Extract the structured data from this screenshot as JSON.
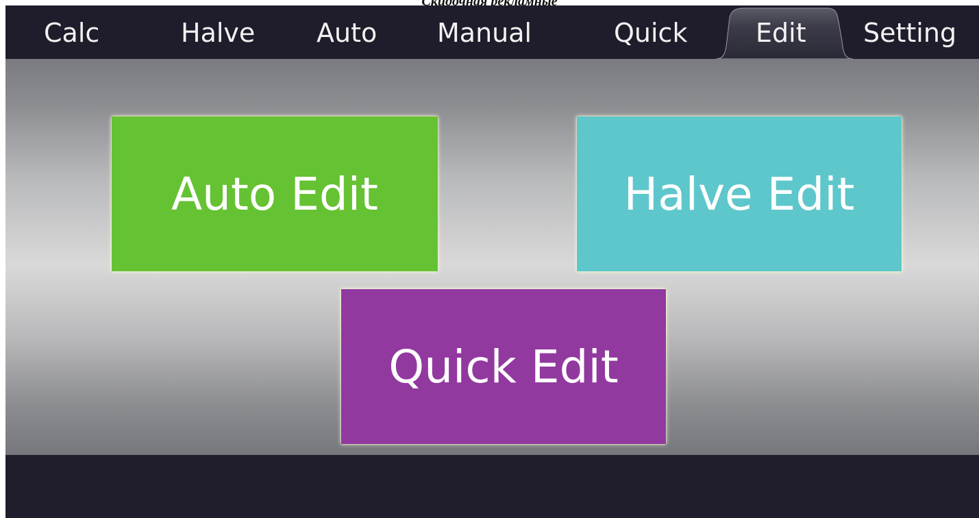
{
  "caption": "Скидочная рекламные",
  "tabs": [
    {
      "label": "Calc",
      "active": false
    },
    {
      "label": "Halve",
      "active": false
    },
    {
      "label": "Auto",
      "active": false
    },
    {
      "label": "Manual",
      "active": false
    },
    {
      "label": "Quick",
      "active": false
    },
    {
      "label": "Edit",
      "active": true
    },
    {
      "label": "Setting",
      "active": false
    }
  ],
  "tiles": {
    "auto_edit": {
      "label": "Auto Edit",
      "color": "#65c232"
    },
    "halve_edit": {
      "label": "Halve Edit",
      "color": "#5ec7cb"
    },
    "quick_edit": {
      "label": "Quick Edit",
      "color": "#9239a0"
    }
  },
  "colors": {
    "tabbar": "#1f1d2b",
    "tab_text": "#f2f2f2",
    "active_tab": "#3b3a47"
  }
}
